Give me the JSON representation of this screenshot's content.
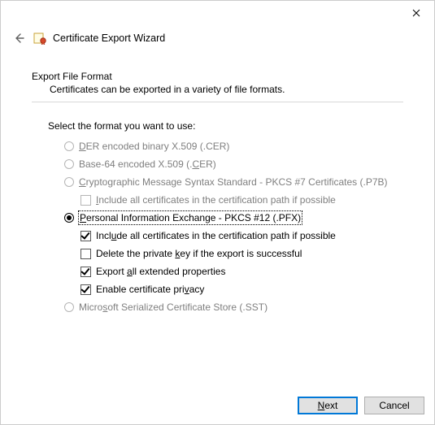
{
  "window": {
    "title": "Certificate Export Wizard"
  },
  "section": {
    "heading": "Export File Format",
    "sub": "Certificates can be exported in a variety of file formats."
  },
  "prompt": "Select the format you want to use:",
  "options": {
    "der": {
      "pre": "",
      "ul": "D",
      "rest": "ER encoded binary X.509 (.CER)"
    },
    "base64": {
      "pre": "Base-64 encoded X.509 (.",
      "ul": "C",
      "rest": "ER)"
    },
    "pkcs7": {
      "pre": "",
      "ul": "C",
      "rest": "ryptographic Message Syntax Standard - PKCS #7 Certificates (.P7B)"
    },
    "pkcs7_inc": {
      "pre": "",
      "ul": "I",
      "rest": "nclude all certificates in the certification path if possible"
    },
    "pfx": {
      "pre": "",
      "ul": "P",
      "rest": "ersonal Information Exchange - PKCS #12 (.PFX)"
    },
    "pfx_inc": {
      "pre": "Incl",
      "ul": "u",
      "rest": "de all certificates in the certification path if possible"
    },
    "pfx_del": {
      "pre": "Delete the private ",
      "ul": "k",
      "rest": "ey if the export is successful"
    },
    "pfx_ext": {
      "pre": "Export ",
      "ul": "a",
      "rest": "ll extended properties"
    },
    "pfx_priv": {
      "pre": "Enable certificate pri",
      "ul": "v",
      "rest": "acy"
    },
    "sst": {
      "pre": "Micro",
      "ul": "s",
      "rest": "oft Serialized Certificate Store (.SST)"
    }
  },
  "footer": {
    "next_ul": "N",
    "next_rest": "ext",
    "cancel": "Cancel"
  }
}
